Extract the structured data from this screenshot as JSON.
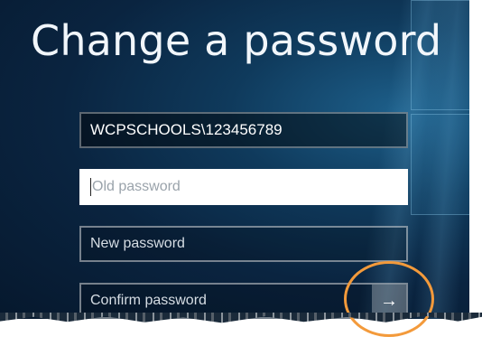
{
  "title": "Change a password",
  "fields": {
    "username_value": "WCPSCHOOLS\\123456789",
    "old_password_placeholder": "Old password",
    "new_password_placeholder": "New password",
    "confirm_password_placeholder": "Confirm password"
  },
  "submit": {
    "icon": "arrow-right-icon",
    "glyph": "→"
  },
  "colors": {
    "background": "#0a2440",
    "highlight_ring": "#f39a3b"
  }
}
